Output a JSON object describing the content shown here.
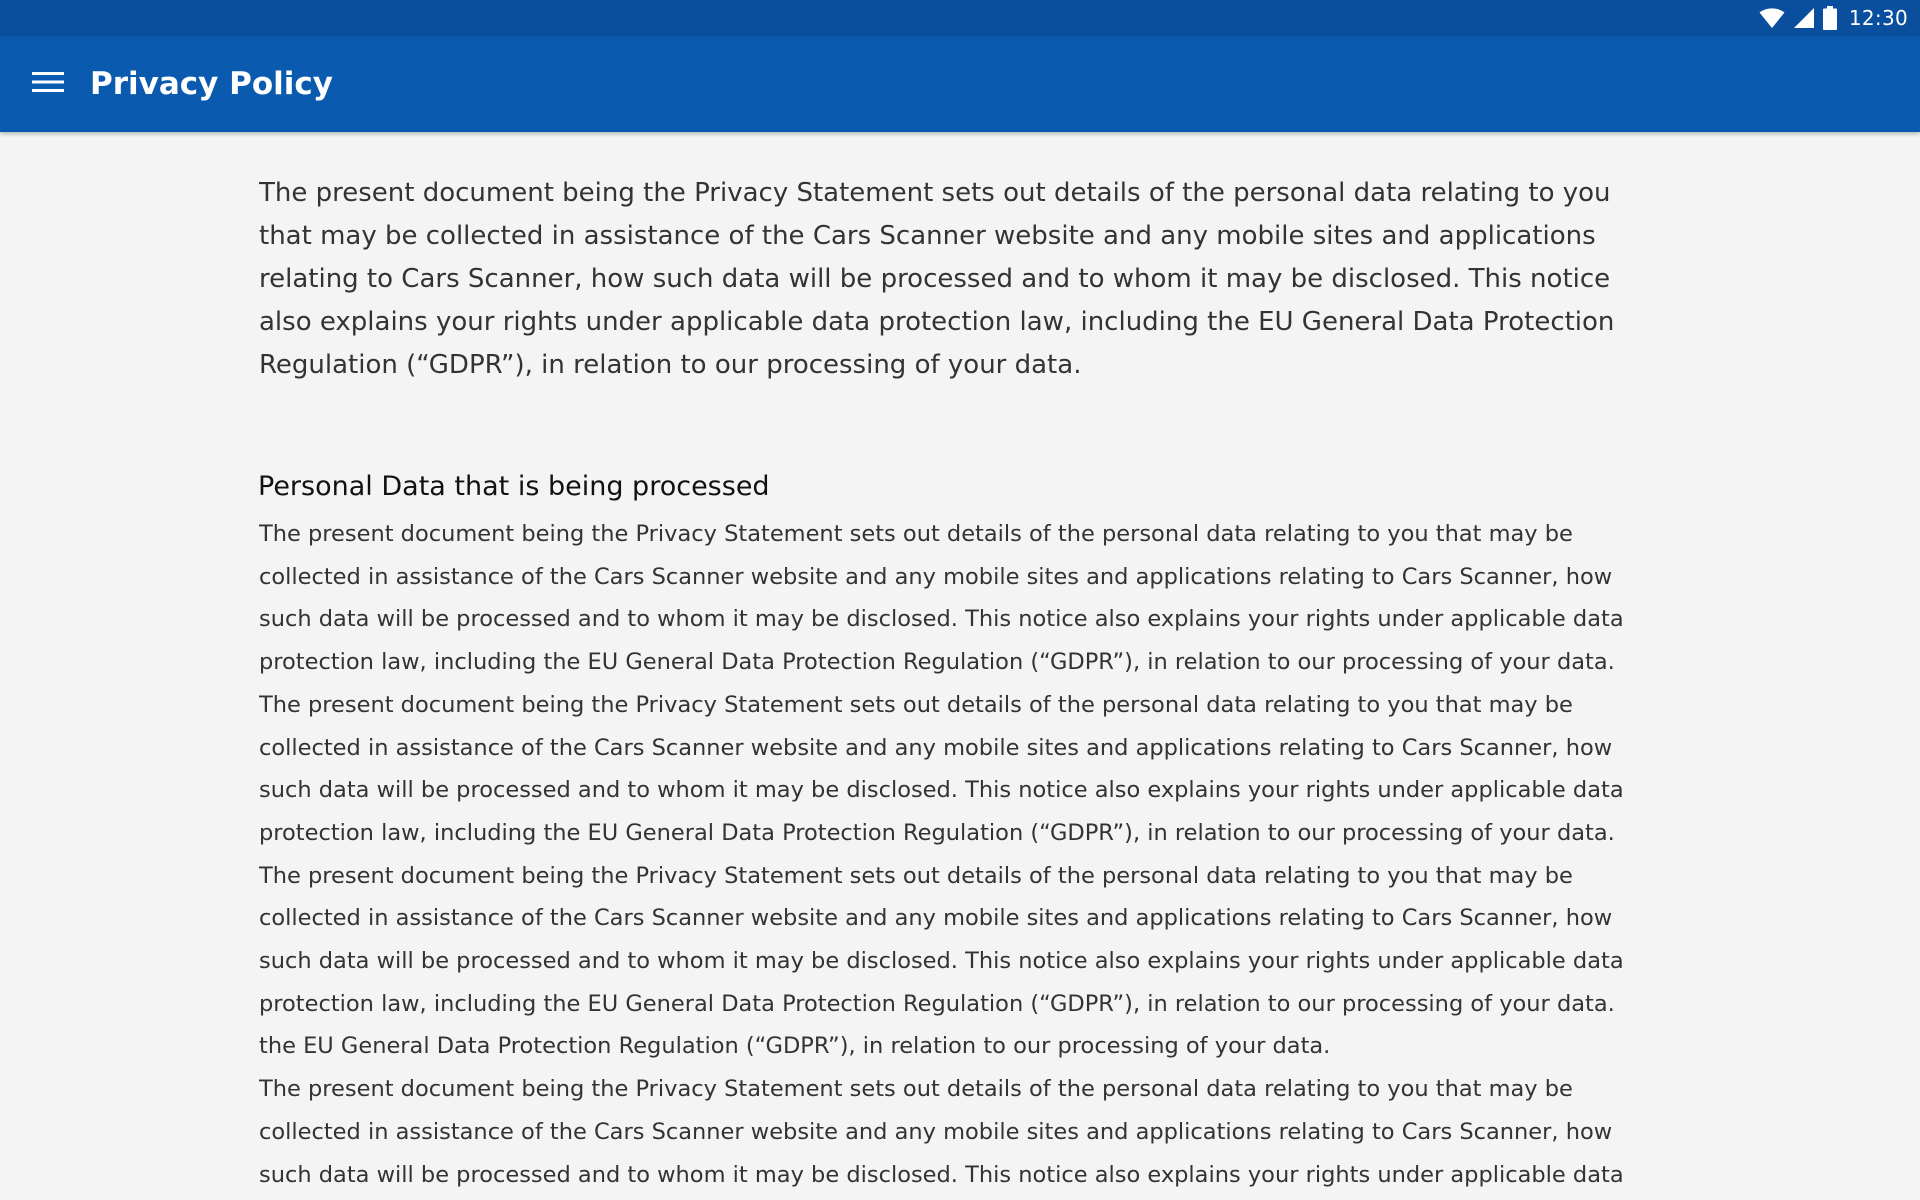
{
  "status_bar": {
    "time": "12:30",
    "icons": [
      "wifi-icon",
      "cell-signal-icon",
      "battery-icon"
    ],
    "background": "#0a4f9e"
  },
  "app_bar": {
    "title": "Privacy Policy",
    "menu_icon": "hamburger-menu-icon",
    "background": "#0a5bb0"
  },
  "content": {
    "intro": "The present document being the Privacy Statement sets out details of the personal data relating to you that may be collected in assistance of the Cars Scanner website and any mobile sites and applications relating to Cars Scanner, how such data will be processed and to whom it may be disclosed. This notice also explains your rights under applicable data protection law, including the EU General Data Protection Regulation (“GDPR”), in relation to our processing of your data.",
    "section_heading": "Personal Data that is being processed",
    "paragraphs": [
      "The present document being the Privacy Statement sets out details of the personal data relating to you that may be collected in assistance of the Cars Scanner website and any mobile sites and applications relating to Cars Scanner, how such data will be processed and to whom it may be disclosed. This notice also explains your rights under applicable data protection law, including the EU General Data Protection Regulation (“GDPR”), in relation to our processing of your data.",
      "The present document being the Privacy Statement sets out details of the personal data relating to you that may be collected in assistance of the Cars Scanner website and any mobile sites and applications relating to Cars Scanner, how such data will be processed and to whom it may be disclosed. This notice also explains your rights under applicable data protection law, including the EU General Data Protection Regulation (“GDPR”), in relation to our processing of your data.",
      "The present document being the Privacy Statement sets out details of the personal data relating to you that may be collected in assistance of the Cars Scanner website and any mobile sites and applications relating to Cars Scanner, how such data will be processed and to whom it may be disclosed. This notice also explains your rights under applicable data protection law, including the EU General Data Protection Regulation (“GDPR”), in relation to our processing of your data.",
      "the EU General Data Protection Regulation (“GDPR”), in relation to our processing of your data.",
      "The present document being the Privacy Statement sets out details of the personal data relating to you that may be collected in assistance of the Cars Scanner website and any mobile sites and applications relating to Cars Scanner, how such data will be processed and to whom it may be disclosed. This notice also explains your rights under applicable data protection law, including"
    ]
  }
}
